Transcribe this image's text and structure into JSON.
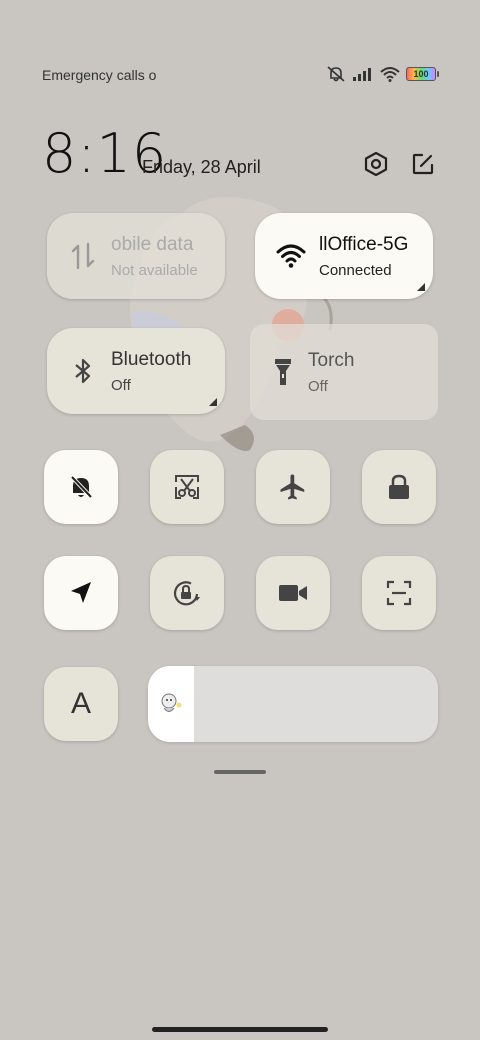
{
  "status_bar": {
    "left_text": "Emergency calls o",
    "battery": "100"
  },
  "header": {
    "time": "8:16",
    "date": "Friday, 28 April"
  },
  "tiles": {
    "mobile_data": {
      "title": "obile data",
      "subtitle": "Not available"
    },
    "wifi": {
      "title": "llOffice-5G",
      "subtitle": "Connected"
    },
    "bluetooth": {
      "title": "Bluetooth",
      "subtitle": "Off"
    },
    "torch": {
      "title": "Torch",
      "subtitle": "Off"
    }
  },
  "auto_brightness_label": "A",
  "brightness_level": 0.16,
  "toggles_row1": [
    "silent-icon",
    "screenshot-icon",
    "airplane-icon",
    "lock-icon"
  ],
  "toggles_row2": [
    "location-icon",
    "rotation-lock-icon",
    "video-camera-icon",
    "scanner-icon"
  ]
}
